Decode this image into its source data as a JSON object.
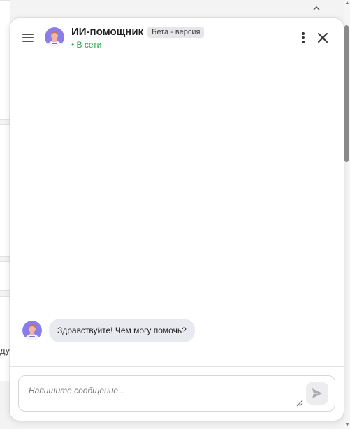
{
  "header": {
    "title": "ИИ-помощник",
    "badge": "Бета - версия",
    "status": "• В сети",
    "menu_icon": "menu-icon",
    "more_icon": "more-vertical-icon",
    "close_icon": "close-icon"
  },
  "messages": [
    {
      "sender": "assistant",
      "text": "Здравствуйте! Чем могу помочь?"
    }
  ],
  "composer": {
    "placeholder": "Напишите сообщение...",
    "value": "",
    "send_icon": "send-icon"
  },
  "background": {
    "edge_text": "ду"
  },
  "colors": {
    "online": "#22a547",
    "bubble": "#e9e9f0",
    "avatar_bg": "#8a7de8"
  }
}
